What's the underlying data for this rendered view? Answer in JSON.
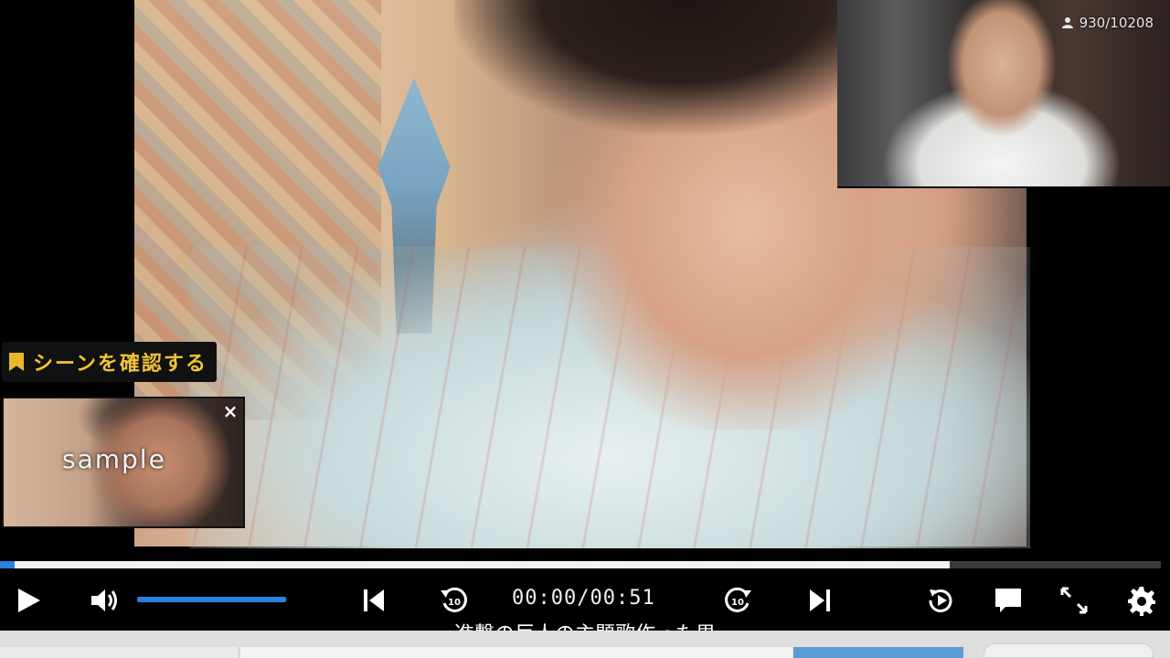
{
  "viewer_count": {
    "icon": "person-icon",
    "text": "930/10208"
  },
  "scene_check": {
    "icon": "bookmark-icon",
    "label": "シーンを確認する",
    "color": "#f0c437"
  },
  "sample_thumbnail": {
    "text": "sample",
    "close_icon": "×"
  },
  "progress": {
    "played_fraction": 0.0126,
    "buffered_fraction": 0.818,
    "played_color": "#2d7fe0"
  },
  "controls": {
    "play_icon": "play-icon",
    "volume_icon": "volume-icon",
    "volume_level": 1.0,
    "skip_back_icon": "skip-previous-icon",
    "rewind_icon": "rewind-10-icon",
    "time_display": "00:00/00:51",
    "forward_icon": "forward-10-icon",
    "skip_next_icon": "skip-next-icon",
    "replay_icon": "replay-icon",
    "comment_icon": "comment-icon",
    "fullscreen_icon": "fullscreen-icon",
    "settings_icon": "gear-icon"
  },
  "caption": "進撃の巨人の主題歌作った男"
}
